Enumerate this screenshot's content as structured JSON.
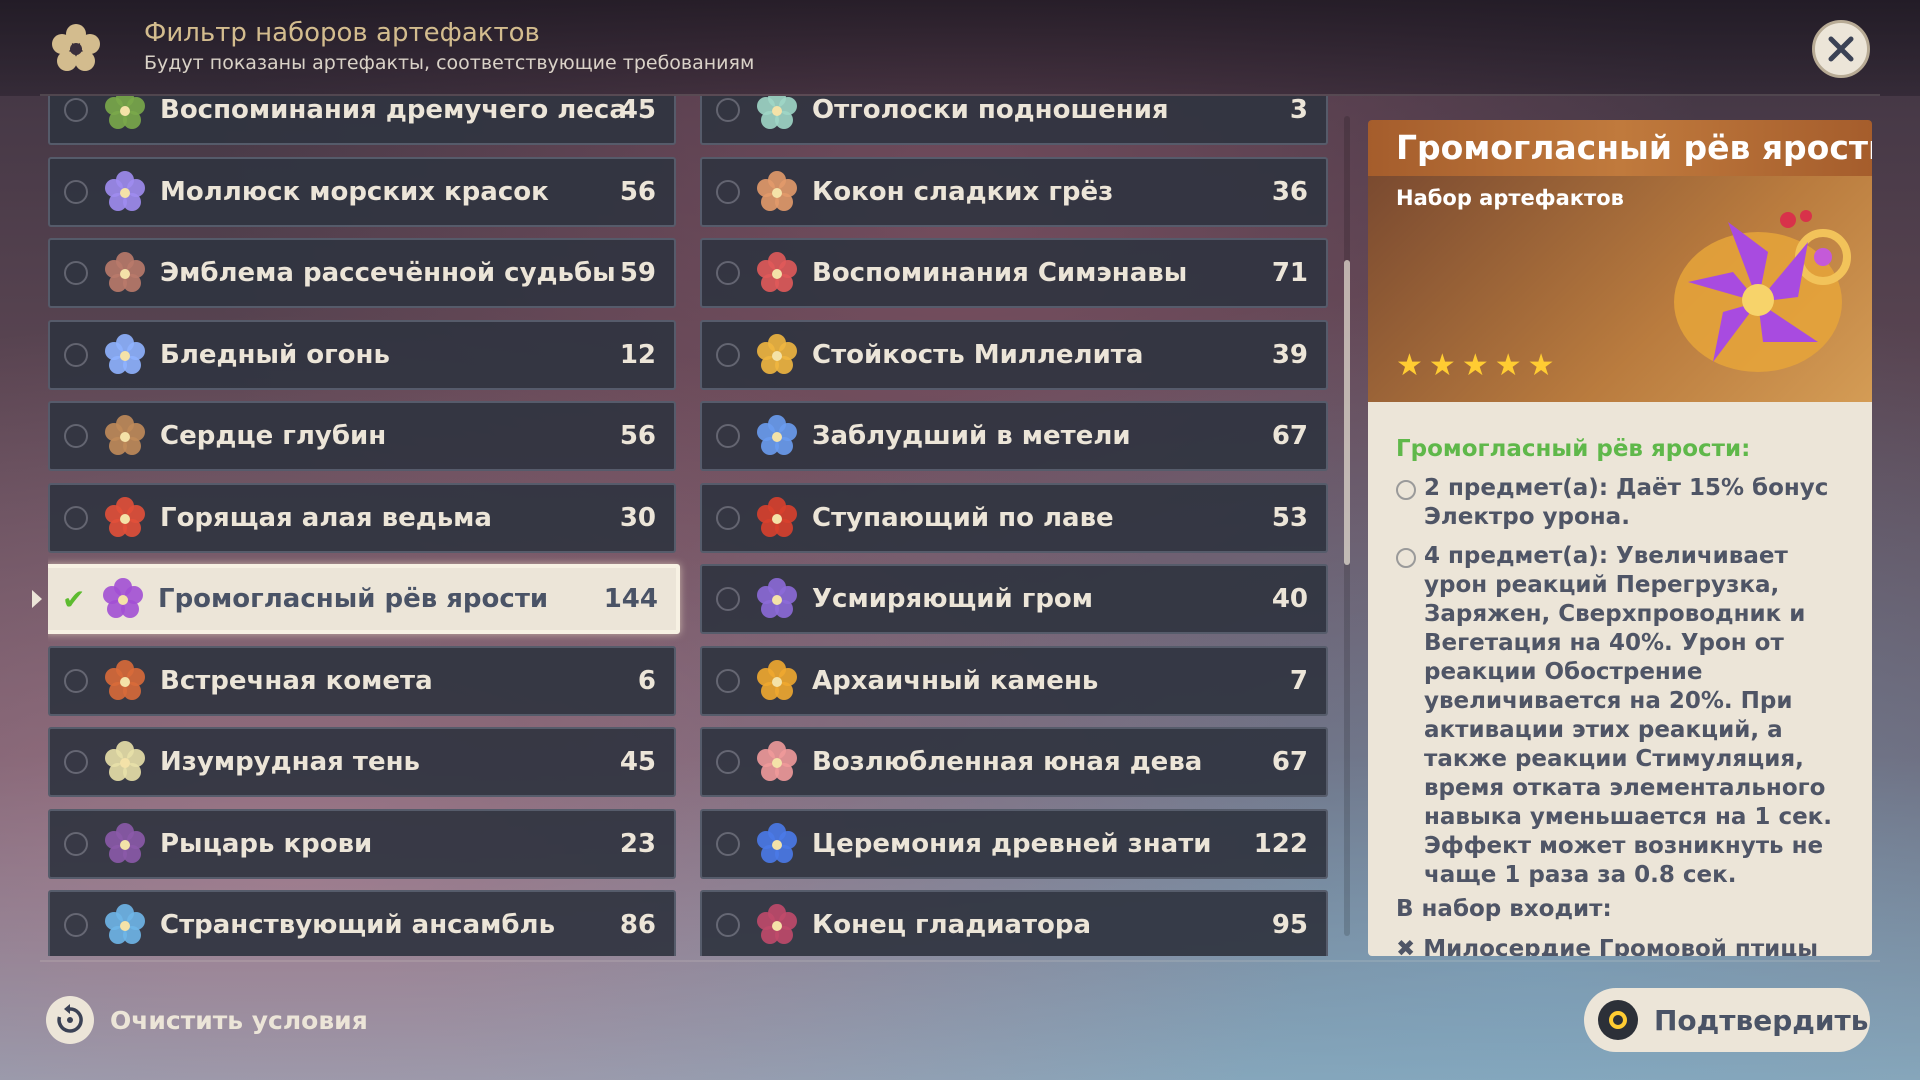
{
  "header": {
    "title": "Фильтр наборов артефактов",
    "subtitle": "Будут показаны артефакты, соответствующие требованиям"
  },
  "sets_left": [
    {
      "name": "Воспоминания дремучего леса",
      "count": "45",
      "icon": "deepwood-flower-icon",
      "color": "#7aa84a",
      "selected": false
    },
    {
      "name": "Моллюск морских красок",
      "count": "56",
      "icon": "ocean-clam-flower-icon",
      "color": "#9f8cf0",
      "selected": false
    },
    {
      "name": "Эмблема рассечённой судьбы",
      "count": "59",
      "icon": "emblem-flower-icon",
      "color": "#b97a6a",
      "selected": false
    },
    {
      "name": "Бледный огонь",
      "count": "12",
      "icon": "pale-flame-flower-icon",
      "color": "#8fb2ff",
      "selected": false
    },
    {
      "name": "Сердце глубин",
      "count": "56",
      "icon": "heart-of-depth-flower-icon",
      "color": "#c08b5a",
      "selected": false
    },
    {
      "name": "Горящая алая ведьма",
      "count": "30",
      "icon": "crimson-witch-flower-icon",
      "color": "#e2503a",
      "selected": false
    },
    {
      "name": "Громогласный рёв ярости",
      "count": "144",
      "icon": "thundering-fury-flower-icon",
      "color": "#a24fd4",
      "selected": true
    },
    {
      "name": "Встречная комета",
      "count": "6",
      "icon": "retracing-bolide-flower-icon",
      "color": "#d86a3a",
      "selected": false
    },
    {
      "name": "Изумрудная тень",
      "count": "45",
      "icon": "viridescent-flower-icon",
      "color": "#e8e0a8",
      "selected": false
    },
    {
      "name": "Рыцарь крови",
      "count": "23",
      "icon": "bloodstained-flower-icon",
      "color": "#8b5aa8",
      "selected": false
    },
    {
      "name": "Странствующий ансамбль",
      "count": "86",
      "icon": "wanderers-troupe-flower-icon",
      "color": "#6fb6e8",
      "selected": false
    }
  ],
  "sets_right": [
    {
      "name": "Отголоски подношения",
      "count": "3",
      "icon": "echoes-flower-icon",
      "color": "#9fd6c6",
      "selected": false
    },
    {
      "name": "Кокон сладких грёз",
      "count": "36",
      "icon": "husk-flower-icon",
      "color": "#e29a6a",
      "selected": false
    },
    {
      "name": "Воспоминания Симэнавы",
      "count": "71",
      "icon": "shimenawa-flower-icon",
      "color": "#e05a5a",
      "selected": false
    },
    {
      "name": "Стойкость Миллелита",
      "count": "39",
      "icon": "millelith-flower-icon",
      "color": "#f0b640",
      "selected": false
    },
    {
      "name": "Заблудший в метели",
      "count": "67",
      "icon": "blizzard-flower-icon",
      "color": "#6a9cf0",
      "selected": false
    },
    {
      "name": "Ступающий по лаве",
      "count": "53",
      "icon": "lavawalker-flower-icon",
      "color": "#d8402e",
      "selected": false
    },
    {
      "name": "Усмиряющий гром",
      "count": "40",
      "icon": "thundersoother-flower-icon",
      "color": "#8c6ad8",
      "selected": false
    },
    {
      "name": "Архаичный камень",
      "count": "7",
      "icon": "archaic-petra-flower-icon",
      "color": "#f0a830",
      "selected": false
    },
    {
      "name": "Возлюбленная юная дева",
      "count": "67",
      "icon": "maiden-flower-icon",
      "color": "#f09a9a",
      "selected": false
    },
    {
      "name": "Церемония древней знати",
      "count": "122",
      "icon": "noblesse-flower-icon",
      "color": "#4a7ae8",
      "selected": false
    },
    {
      "name": "Конец гладиатора",
      "count": "95",
      "icon": "gladiator-flower-icon",
      "color": "#c04a6a",
      "selected": false
    }
  ],
  "detail": {
    "title": "Громогласный рёв ярости",
    "type": "Набор артефактов",
    "rarity_stars": 5,
    "set_name_label": "Громогласный рёв ярости:",
    "bonus_2": "2 предмет(а): Даёт 15% бонус Электро урона.",
    "bonus_4": "4 предмет(а): Увеличивает урон реакций Перегрузка, Заряжен, Сверхпроводник и Вегетация на 40%. Урон от реакции Обострение увеличивается на 20%. При активации этих реакций, а также реакции Стимуляция, время отката элементального навыка уменьшается на 1 сек. Эффект может возникнуть не чаще 1 раза за 0.8 сек.",
    "includes_label": "В набор входит:",
    "piece_1": "Милосердие Громовой птицы"
  },
  "footer": {
    "clear_label": "Очистить условия",
    "confirm_label": "Подтвердить"
  },
  "colors": {
    "accent_gold": "#d3bc8e",
    "panel_cream": "#ece5d8",
    "set_green": "#5fb84a",
    "star_yellow": "#ffcc32",
    "header_orange": "#c07a3d"
  }
}
